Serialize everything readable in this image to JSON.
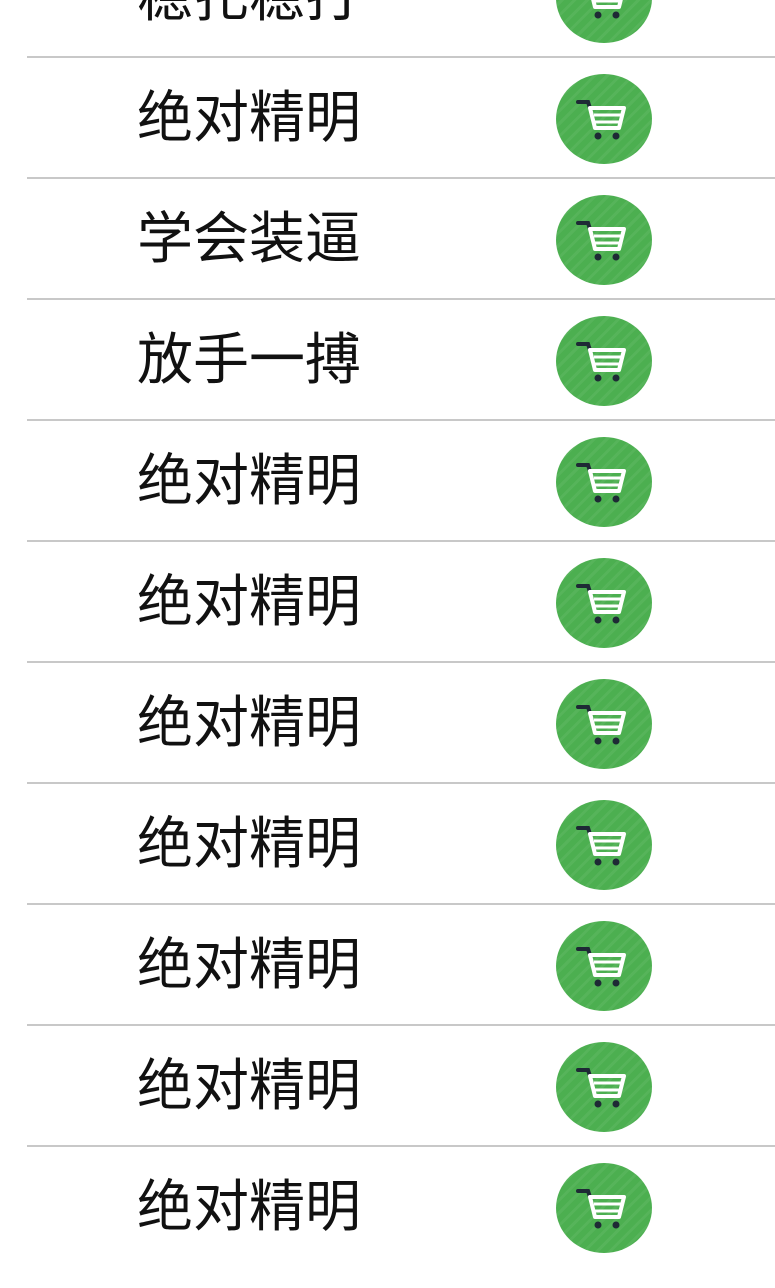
{
  "list": {
    "items": [
      {
        "label": "稳扎稳打",
        "action_icon": "shopping-cart-icon"
      },
      {
        "label": "绝对精明",
        "action_icon": "shopping-cart-icon"
      },
      {
        "label": "学会装逼",
        "action_icon": "shopping-cart-icon"
      },
      {
        "label": "放手一搏",
        "action_icon": "shopping-cart-icon"
      },
      {
        "label": "绝对精明",
        "action_icon": "shopping-cart-icon"
      },
      {
        "label": "绝对精明",
        "action_icon": "shopping-cart-icon"
      },
      {
        "label": "绝对精明",
        "action_icon": "shopping-cart-icon"
      },
      {
        "label": "绝对精明",
        "action_icon": "shopping-cart-icon"
      },
      {
        "label": "绝对精明",
        "action_icon": "shopping-cart-icon"
      },
      {
        "label": "绝对精明",
        "action_icon": "shopping-cart-icon"
      },
      {
        "label": "绝对精明",
        "action_icon": "shopping-cart-icon"
      }
    ]
  },
  "colors": {
    "button_green": "#4caf50",
    "icon_dark": "#1e2a35",
    "icon_white": "#ffffff",
    "divider": "#c8c8c8",
    "text": "#111111"
  }
}
